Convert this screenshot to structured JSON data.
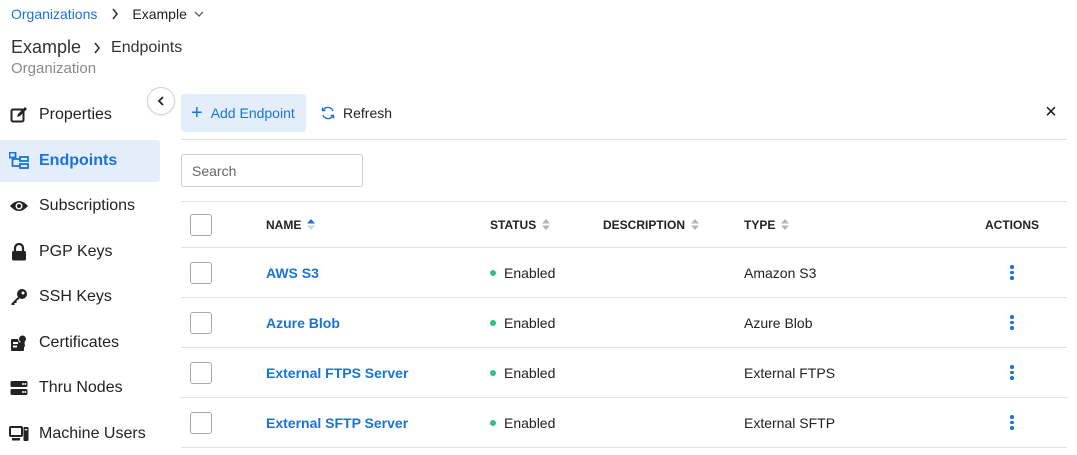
{
  "breadcrumb": {
    "root": "Organizations",
    "current": "Example"
  },
  "header": {
    "title": "Example",
    "section": "Endpoints",
    "subtitle": "Organization"
  },
  "sidebar": {
    "items": [
      {
        "label": "Properties",
        "icon": "edit-icon"
      },
      {
        "label": "Endpoints",
        "icon": "endpoints-tree-icon",
        "active": true
      },
      {
        "label": "Subscriptions",
        "icon": "eye-icon"
      },
      {
        "label": "PGP Keys",
        "icon": "lock-icon"
      },
      {
        "label": "SSH Keys",
        "icon": "key-icon"
      },
      {
        "label": "Certificates",
        "icon": "certificate-icon"
      },
      {
        "label": "Thru Nodes",
        "icon": "server-icon"
      },
      {
        "label": "Machine Users",
        "icon": "computer-icon"
      }
    ]
  },
  "toolbar": {
    "add_label": "Add Endpoint",
    "refresh_label": "Refresh",
    "close_glyph": "×"
  },
  "search": {
    "placeholder": "Search",
    "value": ""
  },
  "table": {
    "columns": {
      "name": "NAME",
      "status": "STATUS",
      "description": "DESCRIPTION",
      "type": "TYPE",
      "actions": "ACTIONS"
    },
    "rows": [
      {
        "name": "AWS S3",
        "status": "Enabled",
        "description": "",
        "type": "Amazon S3"
      },
      {
        "name": "Azure Blob",
        "status": "Enabled",
        "description": "",
        "type": "Azure Blob"
      },
      {
        "name": "External FTPS Server",
        "status": "Enabled",
        "description": "",
        "type": "External FTPS"
      },
      {
        "name": "External SFTP Server",
        "status": "Enabled",
        "description": "",
        "type": "External SFTP"
      }
    ]
  },
  "colors": {
    "accent": "#1a73d9",
    "active_bg": "#e4eefa",
    "status_enabled": "#2ec27e"
  }
}
